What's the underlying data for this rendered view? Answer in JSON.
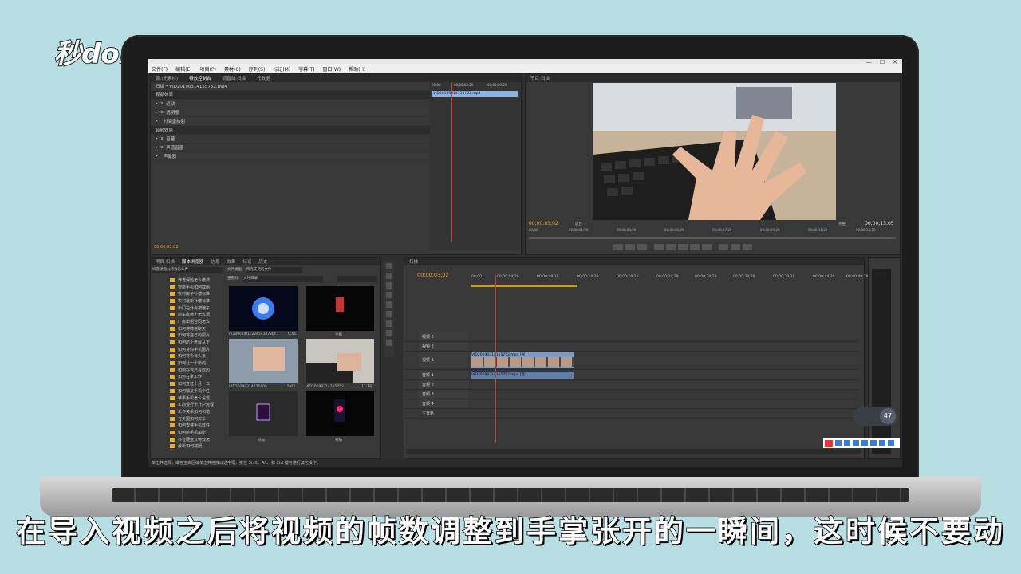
{
  "logo": {
    "text": "秒dong视频"
  },
  "subtitle": "在导入视频之后将视频的帧数调整到手掌张开的一瞬间，这时候不要动",
  "menu": [
    "文件(F)",
    "编辑(E)",
    "项目(P)",
    "素材(C)",
    "序列(S)",
    "标记(M)",
    "字幕(T)",
    "窗口(W)",
    "帮助(H)"
  ],
  "source_panel": {
    "tabs": [
      "源:(无素材)",
      "特效控制台",
      "调音台:扫描",
      "元数据"
    ],
    "clip_header": "扫描 * VID20190314155752.mp4",
    "video_effects_label": "视频效果",
    "video_rows": [
      "运动",
      "透明度",
      "时间重映射"
    ],
    "audio_effects_label": "音频效果",
    "audio_rows": [
      "音量",
      "声道音量",
      "声像器"
    ],
    "mini_ruler": [
      "00;00",
      "00;00;04;29",
      "00;00;09;29"
    ],
    "clip_chip": "VID20190314155752.mp4",
    "timecode": "00;00;03;02"
  },
  "program_panel": {
    "tab": "节目:扫描",
    "timecode_left": "00;00;03;02",
    "fit": "适合",
    "full": "完整",
    "timecode_right": "00;00;13;05",
    "ruler": [
      "00;00",
      "00;00;01;29",
      "00;00;03;29",
      "00;00;05;29",
      "00;00;07;29",
      "00;00;09;29",
      "00;00;11;29",
      "00;00;13;29"
    ]
  },
  "project_panel": {
    "tabs": [
      "项目:扫描",
      "媒体浏览器",
      "信息",
      "效果",
      "标记",
      "历史"
    ],
    "path": "抖音硬盘丸特效怎么弄",
    "file_type_label": "文件类型:",
    "file_type_value": "所有支持的文件",
    "view_label": "查看为:",
    "view_value": "文件目录",
    "tree": [
      "养老保险怎么缴费",
      "智能手机如何截图",
      "农村房子补偿标准",
      "农村最新补偿标准",
      "出门在外会被骗子",
      "动车座椅上怎么调",
      "厂房出租合同怎么",
      "如何将微信聊天",
      "如何将自己的照片",
      "如何防止老鼠从下",
      "如何将你手机图片",
      "如何将今日头条",
      "如何让一个新的",
      "如何在自己喜欢的",
      "如何在家工作",
      "如何查过十月一日",
      "如何辅友手机个性",
      "苹果手机怎么设置",
      "工商银行卡开户流程",
      "工作关系如何和谐",
      "在美国如何买车",
      "如何安装手机软件",
      "如何给手机加密",
      "抖音硬盘丸特效怎",
      "最新如何减肥"
    ],
    "thumbs": [
      {
        "name": "m239e2df1c22e543d72bf...",
        "duration": "0:45"
      },
      {
        "name": "手机",
        "duration": ""
      },
      {
        "name": "VID20190314131805",
        "duration": "15:03"
      },
      {
        "name": "VID20190314155752",
        "duration": "17:19"
      },
      {
        "name": "扫描",
        "duration": ""
      },
      {
        "name": "扫描",
        "duration": ""
      }
    ]
  },
  "timeline": {
    "tab": "扫描",
    "timecode": "00;00;03;02",
    "ruler": [
      "00;00",
      "00;00;04;29",
      "00;00;09;29",
      "00;00;14;29",
      "00;00;19;29",
      "00;00;24;29",
      "00;00;29;29",
      "00;00;34;29",
      "00;00;39;29",
      "00;00;44;29",
      "00;00;49;29"
    ],
    "tracks": [
      "视频 3",
      "视频 2",
      "视频 1",
      "音频 1",
      "音频 2",
      "音频 3",
      "音频 4",
      "主音轨"
    ],
    "video_clip": "VID20190314155752.mp4 [视]",
    "audio_clip": "VID20190314155752.mp4 [音]"
  },
  "status_bar": "单击并选择，或在空白区域单击并拖拽以选中框。按住 Shift、Alt、和 Ctrl 键可进行其它操作。",
  "meter_badge": "47",
  "colors": {
    "playhead": "#d33",
    "accent_timecode": "#e8a72b",
    "clip_video": "#7b9cc4",
    "clip_audio": "#5f7fa8"
  }
}
